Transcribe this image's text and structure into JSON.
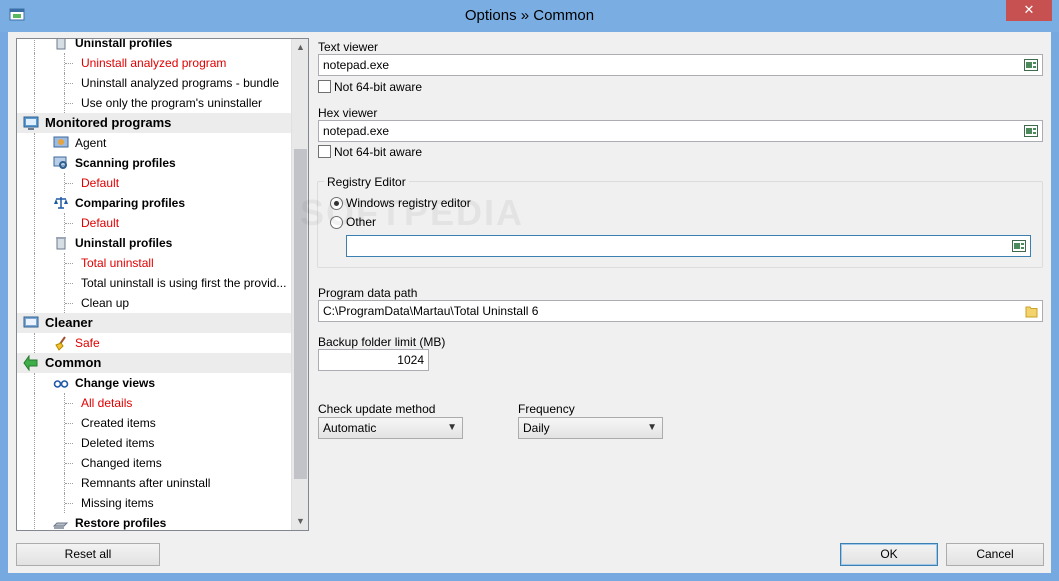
{
  "window": {
    "title": "Options » Common",
    "close_glyph": "✕"
  },
  "tree": {
    "items": [
      {
        "label": "Uninstall profiles",
        "level": 1,
        "kind": "sub",
        "icon": "recycle-bin-icon"
      },
      {
        "label": "Uninstall analyzed program",
        "level": 2,
        "kind": "red"
      },
      {
        "label": "Uninstall analyzed programs - bundle",
        "level": 2,
        "kind": "leaf"
      },
      {
        "label": "Use only the program's uninstaller",
        "level": 2,
        "kind": "leaf"
      },
      {
        "label": "Monitored programs",
        "level": 0,
        "kind": "top",
        "icon": "monitor-programs-icon"
      },
      {
        "label": "Agent",
        "level": 1,
        "kind": "leaf",
        "icon": "agent-icon"
      },
      {
        "label": "Scanning profiles",
        "level": 1,
        "kind": "sub",
        "icon": "scan-icon"
      },
      {
        "label": "Default",
        "level": 2,
        "kind": "red"
      },
      {
        "label": "Comparing profiles",
        "level": 1,
        "kind": "sub",
        "icon": "scales-icon"
      },
      {
        "label": "Default",
        "level": 2,
        "kind": "red"
      },
      {
        "label": "Uninstall profiles",
        "level": 1,
        "kind": "sub",
        "icon": "recycle-bin-icon"
      },
      {
        "label": "Total uninstall",
        "level": 2,
        "kind": "red"
      },
      {
        "label": "Total uninstall is using first the provid...",
        "level": 2,
        "kind": "leaf"
      },
      {
        "label": "Clean up",
        "level": 2,
        "kind": "leaf"
      },
      {
        "label": "Cleaner",
        "level": 0,
        "kind": "top",
        "icon": "cleaner-icon"
      },
      {
        "label": "Safe",
        "level": 1,
        "kind": "red",
        "icon": "broom-icon"
      },
      {
        "label": "Common",
        "level": 0,
        "kind": "top",
        "icon": "green-arrow-icon"
      },
      {
        "label": "Change views",
        "level": 1,
        "kind": "sub",
        "icon": "glasses-icon"
      },
      {
        "label": "All details",
        "level": 2,
        "kind": "red"
      },
      {
        "label": "Created items",
        "level": 2,
        "kind": "leaf"
      },
      {
        "label": "Deleted items",
        "level": 2,
        "kind": "leaf"
      },
      {
        "label": "Changed items",
        "level": 2,
        "kind": "leaf"
      },
      {
        "label": "Remnants after uninstall",
        "level": 2,
        "kind": "leaf"
      },
      {
        "label": "Missing items",
        "level": 2,
        "kind": "leaf"
      },
      {
        "label": "Restore profiles",
        "level": 1,
        "kind": "sub",
        "icon": "restore-icon"
      }
    ]
  },
  "text_viewer": {
    "label": "Text viewer",
    "value": "notepad.exe",
    "checkbox_label": "Not 64-bit aware"
  },
  "hex_viewer": {
    "label": "Hex viewer",
    "value": "notepad.exe",
    "checkbox_label": "Not 64-bit aware"
  },
  "registry_editor": {
    "label": "Registry Editor",
    "option_windows": "Windows registry editor",
    "option_other": "Other",
    "other_value": ""
  },
  "program_data_path": {
    "label": "Program data path",
    "value": "C:\\ProgramData\\Martau\\Total Uninstall 6"
  },
  "backup_folder_limit": {
    "label": "Backup folder limit (MB)",
    "value": "1024"
  },
  "check_update_method": {
    "label": "Check update method",
    "selected": "Automatic"
  },
  "frequency": {
    "label": "Frequency",
    "selected": "Daily"
  },
  "buttons": {
    "reset_all": "Reset all",
    "ok": "OK",
    "cancel": "Cancel"
  },
  "watermark": "SOFTPEDIA",
  "colors": {
    "titlebar": "#7aaee3",
    "close": "#c75050",
    "red_item": "#e00000"
  }
}
